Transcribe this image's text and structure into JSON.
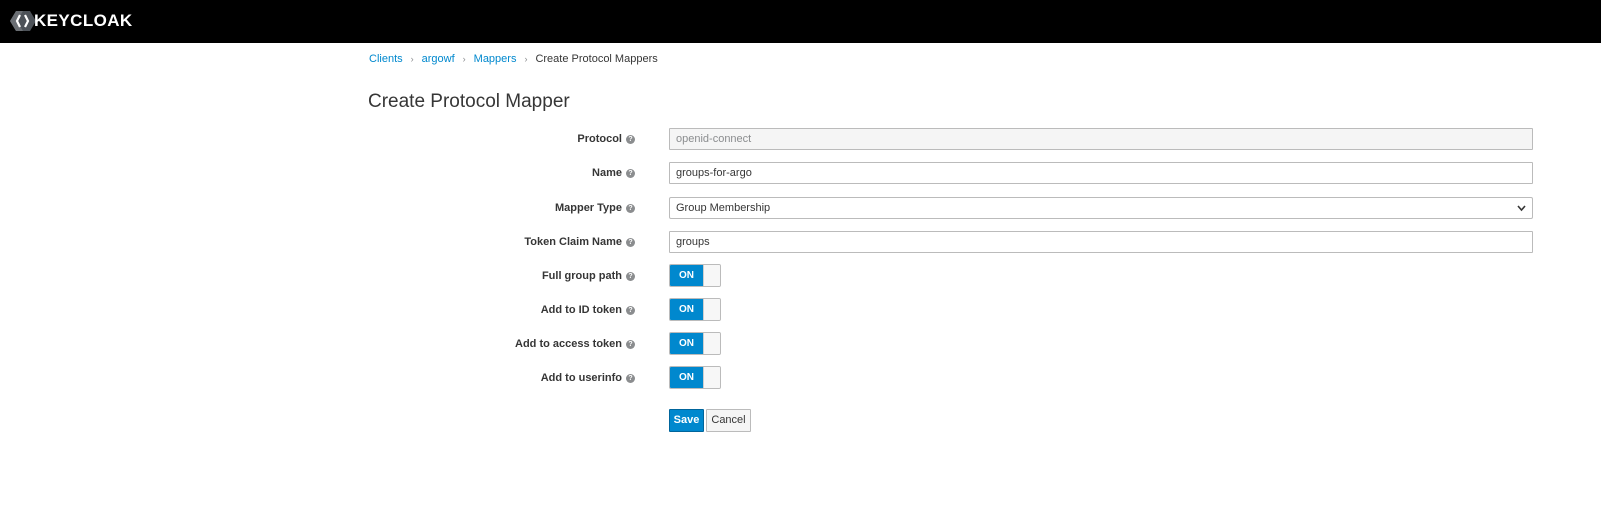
{
  "brand": {
    "name": "KEYCLOAK",
    "logo_icon": "keycloak-hexagon-icon",
    "logo_color": "#4d5258",
    "accent": "#0088ce"
  },
  "breadcrumb": {
    "items": [
      "Clients",
      "argowf",
      "Mappers"
    ],
    "current": "Create Protocol Mappers",
    "separator": "›"
  },
  "page": {
    "title": "Create Protocol Mapper"
  },
  "form": {
    "protocol": {
      "label": "Protocol",
      "value": "openid-connect"
    },
    "name": {
      "label": "Name",
      "value": "groups-for-argo"
    },
    "mapper_type": {
      "label": "Mapper Type",
      "value": "Group Membership"
    },
    "token_claim_name": {
      "label": "Token Claim Name",
      "value": "groups"
    },
    "full_group_path": {
      "label": "Full group path",
      "state": "ON"
    },
    "add_to_id_token": {
      "label": "Add to ID token",
      "state": "ON"
    },
    "add_to_access_token": {
      "label": "Add to access token",
      "state": "ON"
    },
    "add_to_userinfo": {
      "label": "Add to userinfo",
      "state": "ON"
    },
    "help_icon": "question-circle-icon"
  },
  "actions": {
    "save_label": "Save",
    "cancel_label": "Cancel"
  }
}
